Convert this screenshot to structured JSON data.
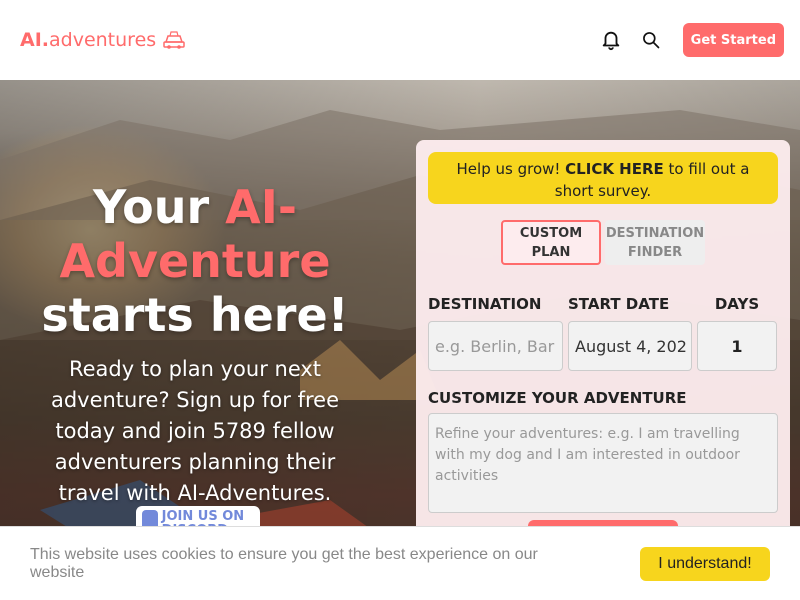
{
  "header": {
    "logo_ai": "AI.",
    "logo_rest": "adventures",
    "cta": "Get Started",
    "icons": [
      "bell-icon",
      "search-icon"
    ]
  },
  "hero": {
    "title_your": "Your ",
    "title_ai": "AI-",
    "title_adventure": "Adventure",
    "title_rest": "starts here!",
    "subtitle": "Ready to plan your next adventure? Sign up for free today and join 5789 fellow adventurers planning their travel with AI-Adventures.",
    "discord": "JOIN US ON DISCORD"
  },
  "form": {
    "survey_prefix": "Help us grow! ",
    "survey_link": "CLICK HERE",
    "survey_suffix": " to fill out a short survey.",
    "tabs": [
      {
        "label": "CUSTOM PLAN",
        "active": true
      },
      {
        "label": "DESTINATION FINDER",
        "active": false
      }
    ],
    "destination_label": "DESTINATION",
    "destination_placeholder": "e.g. Berlin, Bar",
    "start_date_label": "START DATE",
    "start_date_value": "August 4, 202",
    "days_label": "DAYS",
    "days_value": "1",
    "customize_label": "CUSTOMIZE YOUR ADVENTURE",
    "customize_placeholder": "Refine your adventures: e.g. I am travelling with my dog and I am interested in outdoor activities"
  },
  "cookie": {
    "text": "This website uses cookies to ensure you get the best experience on our website",
    "button": "I understand!"
  },
  "colors": {
    "accent": "#ff6b6b",
    "survey_bg": "#f7d51d",
    "discord": "#7289da"
  }
}
